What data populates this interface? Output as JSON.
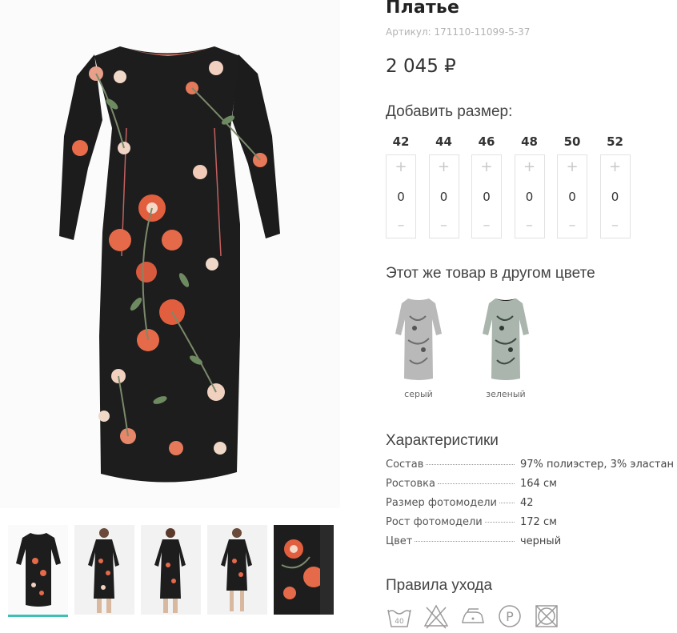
{
  "product": {
    "title": "Платье",
    "article": "Артикул: 171110-11099-5-37",
    "price": "2 045 ₽"
  },
  "sizes": {
    "title": "Добавить размер:",
    "plus": "+",
    "minus": "–",
    "items": [
      {
        "label": "42",
        "qty": "0"
      },
      {
        "label": "44",
        "qty": "0"
      },
      {
        "label": "46",
        "qty": "0"
      },
      {
        "label": "48",
        "qty": "0"
      },
      {
        "label": "50",
        "qty": "0"
      },
      {
        "label": "52",
        "qty": "0"
      }
    ]
  },
  "colors": {
    "title": "Этот же товар в другом цвете",
    "items": [
      {
        "name": "серый"
      },
      {
        "name": "зеленый"
      }
    ]
  },
  "characteristics": {
    "title": "Характеристики",
    "rows": [
      {
        "key": "Состав",
        "value": "97% полиэстер, 3% эластан"
      },
      {
        "key": "Ростовка",
        "value": "164 см"
      },
      {
        "key": "Размер фотомодели",
        "value": "42"
      },
      {
        "key": "Рост фотомодели",
        "value": "172 см"
      },
      {
        "key": "Цвет",
        "value": "черный"
      }
    ]
  },
  "care": {
    "title": "Правила ухода",
    "wash_temp": "40",
    "dry_clean_letter": "P",
    "icons": [
      "wash-40-icon",
      "no-bleach-icon",
      "iron-low-icon",
      "dry-clean-p-icon",
      "no-tumble-dry-icon"
    ]
  },
  "colors_palette": {
    "accent": "#3fc0b4",
    "dress_black": "#1a1a1a",
    "flower_orange": "#e46a4a"
  }
}
